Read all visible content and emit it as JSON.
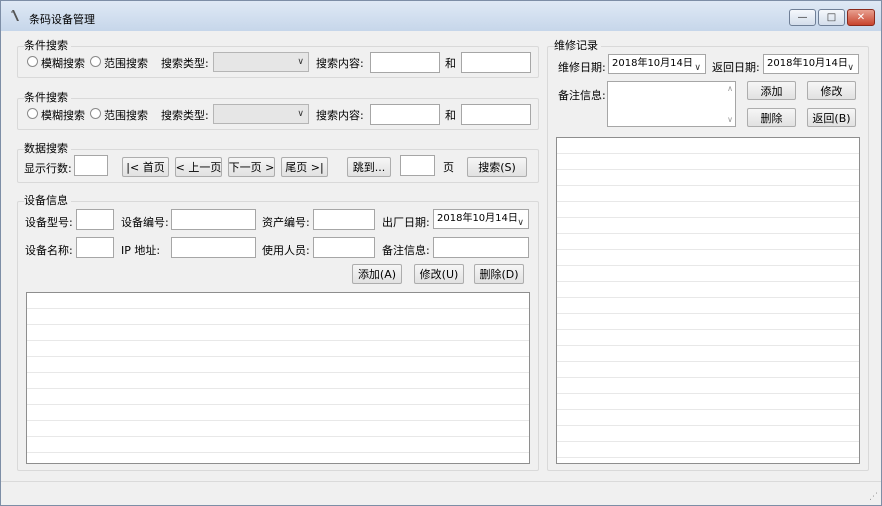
{
  "window": {
    "title": "条码设备管理",
    "minimize_glyph": "—",
    "maximize_glyph": "□",
    "close_glyph": "✕"
  },
  "search1": {
    "group_title": "条件搜索",
    "fuzzy_label": "模糊搜索",
    "range_label": "范围搜索",
    "type_label": "搜索类型:",
    "type_value": "",
    "content_label": "搜索内容:",
    "content_value": "",
    "and_label": "和",
    "and_value": ""
  },
  "search2": {
    "group_title": "条件搜索",
    "fuzzy_label": "模糊搜索",
    "range_label": "范围搜索",
    "type_label": "搜索类型:",
    "type_value": "",
    "content_label": "搜索内容:",
    "content_value": "",
    "and_label": "和",
    "and_value": ""
  },
  "data_search": {
    "group_title": "数据搜索",
    "rows_label": "显示行数:",
    "rows_value": "",
    "first_label": "|< 首页",
    "prev_label": "< 上一页",
    "next_label": "下一页 >",
    "last_label": "尾页 >|",
    "goto_label": "跳到...",
    "page_value": "",
    "page_label": "页",
    "search_button": "搜索(S)"
  },
  "device": {
    "group_title": "设备信息",
    "model_label": "设备型号:",
    "model_value": "",
    "code_label": "设备编号:",
    "code_value": "",
    "asset_label": "资产编号:",
    "asset_value": "",
    "date_label": "出厂日期:",
    "date_value": "2018年10月14日",
    "name_label": "设备名称:",
    "name_value": "",
    "ip_label": "IP  地址:",
    "ip_value": "",
    "user_label": "使用人员:",
    "user_value": "",
    "note_label": "备注信息:",
    "note_value": "",
    "add_button": "添加(A)",
    "edit_button": "修改(U)",
    "delete_button": "删除(D)"
  },
  "repair": {
    "group_title": "维修记录",
    "repair_date_label": "维修日期:",
    "repair_date_value": "2018年10月14日",
    "return_date_label": "返回日期:",
    "return_date_value": "2018年10月14日",
    "note_label": "备注信息:",
    "add_button": "添加",
    "edit_button": "修改",
    "delete_button": "删除",
    "back_button": "返回(B)"
  }
}
